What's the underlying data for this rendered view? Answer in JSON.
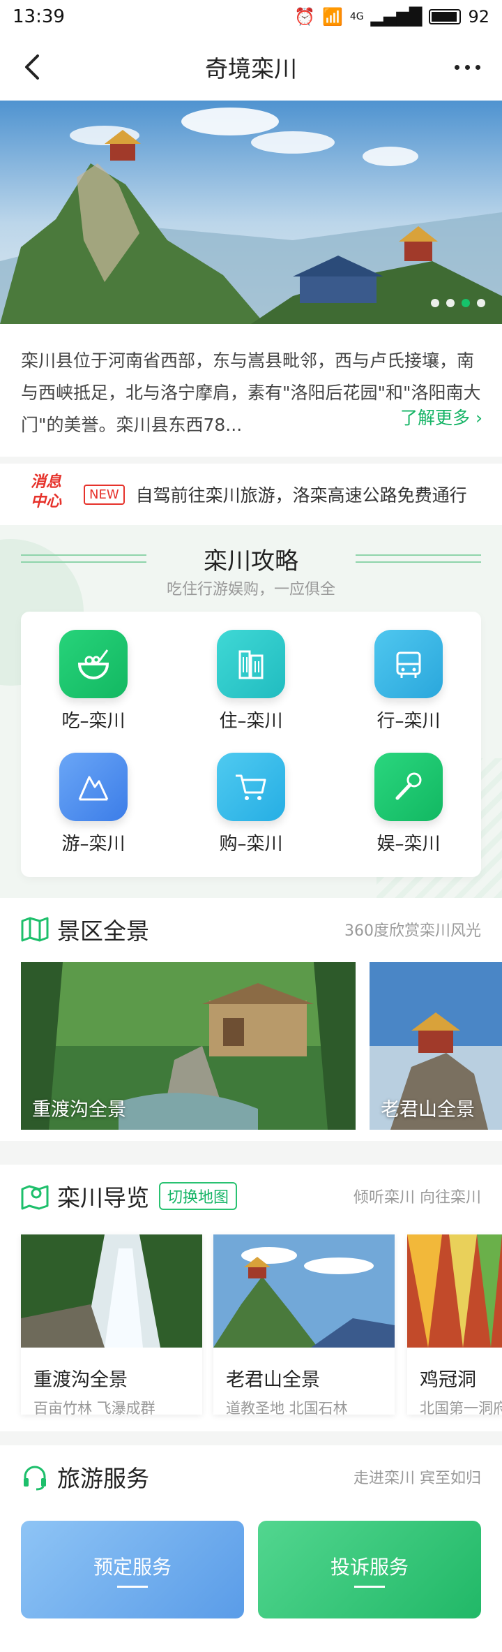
{
  "status_bar": {
    "time": "13:39",
    "network": "4G",
    "battery": "92"
  },
  "nav": {
    "title": "奇境栾川",
    "back_icon": "chevron-left-icon",
    "more_icon": "more-dots-icon"
  },
  "intro": {
    "text": "栾川县位于河南省西部，东与嵩县毗邻，西与卢氏接壤，南与西峡抵足，北与洛宁摩肩，素有\"洛阳后花园\"和\"洛阳南大门\"的美誉。栾川县东西78...",
    "more": "了解更多 ›"
  },
  "news": {
    "logo_line1": "消息",
    "logo_line2": "中心",
    "tag": "NEW",
    "text": "自驾前往栾川旅游，洛栾高速公路免费通行"
  },
  "guide": {
    "title": "栾川攻略",
    "subtitle": "吃住行游娱购，一应俱全",
    "items": [
      {
        "label": "吃–栾川",
        "icon": "food-bowl-icon",
        "color": "#1dc36e"
      },
      {
        "label": "住–栾川",
        "icon": "hotel-building-icon",
        "color": "#2cc8c8"
      },
      {
        "label": "行–栾川",
        "icon": "bus-icon",
        "color": "#3fb8e6"
      },
      {
        "label": "游–栾川",
        "icon": "mountain-icon",
        "color": "#4c8df0"
      },
      {
        "label": "购–栾川",
        "icon": "shopping-cart-icon",
        "color": "#35b7e8"
      },
      {
        "label": "娱–栾川",
        "icon": "microphone-icon",
        "color": "#1bc26a"
      }
    ]
  },
  "panorama": {
    "title": "景区全景",
    "right": "360度欣赏栾川风光",
    "cards": [
      {
        "label": "重渡沟全景"
      },
      {
        "label": "老君山全景"
      }
    ]
  },
  "tour": {
    "title": "栾川导览",
    "switch": "切换地图",
    "right": "倾听栾川 向往栾川",
    "cards": [
      {
        "name": "重渡沟全景",
        "desc": "百亩竹林 飞瀑成群"
      },
      {
        "name": "老君山全景",
        "desc": "道教圣地 北国石林"
      },
      {
        "name": "鸡冠洞",
        "desc": "北国第一洞府"
      }
    ]
  },
  "service": {
    "title": "旅游服务",
    "right": "走进栾川 宾至如归",
    "cards": [
      {
        "label": "预定服务"
      },
      {
        "label": "投诉服务"
      }
    ]
  }
}
